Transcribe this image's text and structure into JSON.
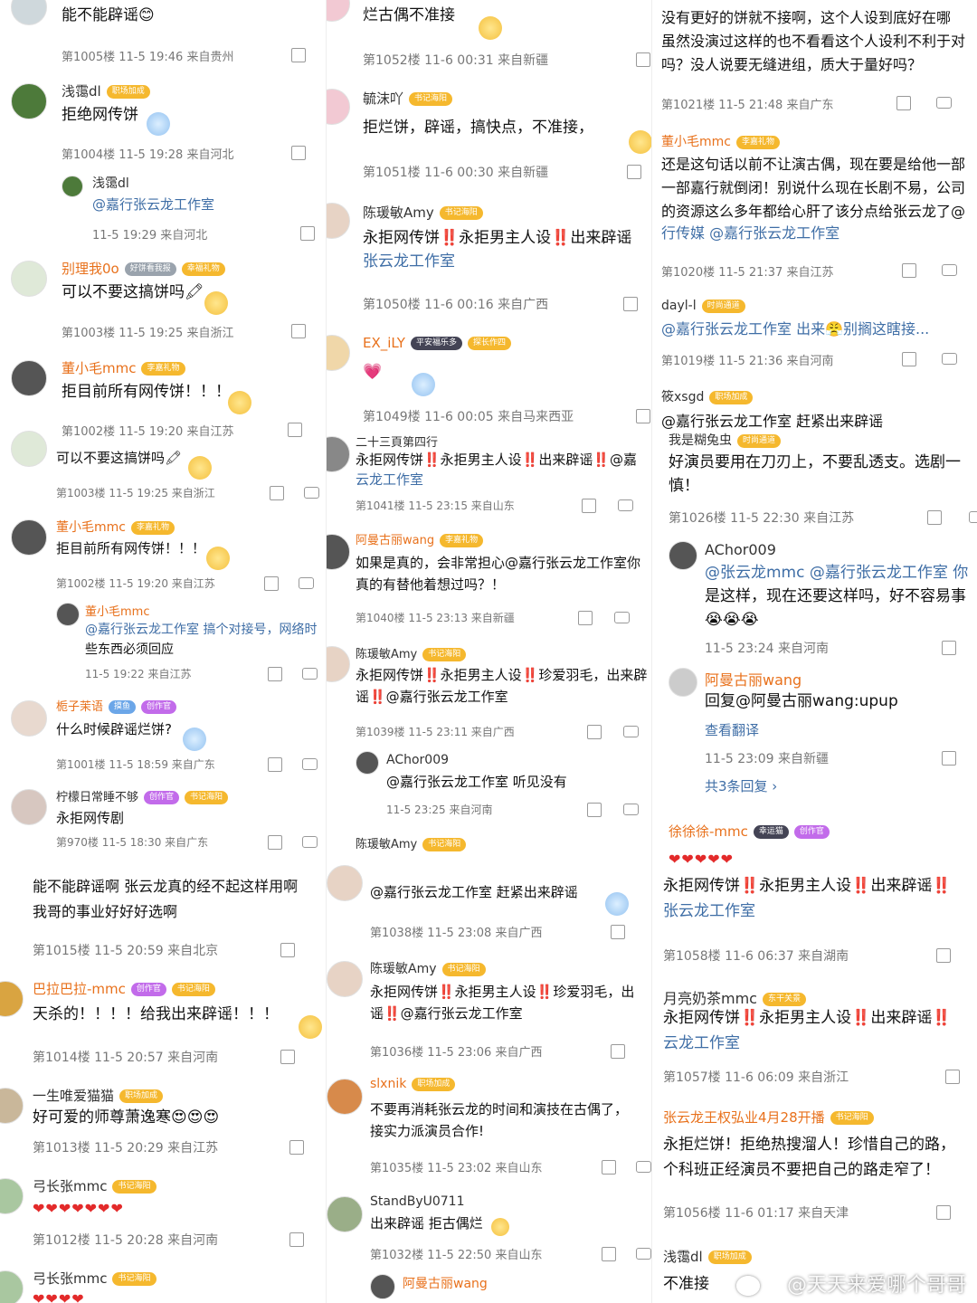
{
  "col1": {
    "e1": {
      "text": "能不能辟谣😊",
      "meta": "第1005楼 11-5 19:46 来自贵州"
    },
    "e2": {
      "name": "浅霭dl",
      "badge": "职场加成",
      "text": "拒绝网传饼",
      "meta": "第1004楼 11-5 19:28 来自河北",
      "reply": {
        "name": "浅霭dl",
        "text": "@嘉行张云龙工作室",
        "meta": "11-5 19:29 来自河北"
      }
    },
    "e3": {
      "name": "别理我0o",
      "badge": "好饼看我报",
      "badge2": "幸福礼物",
      "text": "可以不要这搞饼吗🖍",
      "meta": "第1003楼 11-5 19:25 来自浙江"
    },
    "e4": {
      "name": "董小毛mmc",
      "badge": "李嘉礼物",
      "text": "拒目前所有网传饼！！！",
      "meta": "第1002楼 11-5 19:20 来自江苏"
    },
    "e5": {
      "text": "可以不要这搞饼吗🖍",
      "meta": "第1003楼 11-5 19:25 来自浙江"
    },
    "e6": {
      "name": "董小毛mmc",
      "badge": "李嘉礼物",
      "text": "拒目前所有网传饼！！！",
      "meta": "第1002楼 11-5 19:20 来自江苏",
      "reply": {
        "name": "董小毛mmc",
        "text1": "@嘉行张云龙工作室 搞个对接号，网络时",
        "text2": "些东西必须回应",
        "meta": "11-5 19:22 来自江苏"
      }
    },
    "e7": {
      "name": "栀子茉语",
      "badge": "摸鱼",
      "badge2": "创作官",
      "text": "什么时候辟谣烂饼?",
      "meta": "第1001楼 11-5 18:59 来自广东"
    },
    "e8": {
      "name": "柠檬日常睡不够",
      "badge": "创作官",
      "badge2": "书记海阳",
      "text": "永拒网传剧",
      "meta": "第970楼 11-5 18:30 来自广东"
    },
    "e9": {
      "text1": "能不能辟谣啊 张云龙真的经不起这样用啊",
      "text2": "我哥的事业好好好选啊",
      "meta": "第1015楼 11-5 20:59 来自北京"
    },
    "e10": {
      "name": "巴拉巴拉-mmc",
      "badge": "创作官",
      "badge2": "书记海阳",
      "text": "天杀的！！！！给我出来辟谣！！！",
      "meta": "第1014楼 11-5 20:57 来自河南"
    },
    "e11": {
      "name": "一生唯爱猫猫",
      "badge": "职场加成",
      "text": "好可爱的师尊萧逸寒😍😍😍",
      "meta": "第1013楼 11-5 20:29 来自江苏"
    },
    "e12": {
      "name": "弓长张mmc",
      "badge": "书记海阳",
      "hearts": "❤❤❤❤❤❤❤",
      "meta": "第1012楼 11-5 20:28 来自河南"
    },
    "e13": {
      "name": "弓长张mmc",
      "badge": "书记海阳",
      "hearts": "❤❤❤❤"
    }
  },
  "col2": {
    "e1": {
      "text": "烂古偶不准接",
      "meta": "第1052楼 11-6 00:31 来自新疆"
    },
    "e2": {
      "name": "毓沫吖",
      "badge": "书记海阳",
      "text": "拒烂饼，辟谣，搞快点，不准接，",
      "meta": "第1051楼 11-6 00:30 来自新疆"
    },
    "e3": {
      "name": "陈瑗敏Amy",
      "badge": "书记海阳",
      "text1": "永拒网传饼‼️永拒男主人设‼️出来辟谣",
      "text2": "张云龙工作室",
      "meta": "第1050楼 11-6 00:16 来自广西"
    },
    "e4": {
      "name": "EX_iLY",
      "badge": "平安福乐多",
      "badge2": "探长作四",
      "text": "💗",
      "meta": "第1049楼 11-6 00:05 来自马来西亚"
    },
    "e5": {
      "name": "二十三頁第四行",
      "text1": "永拒网传饼‼️永拒男主人设‼️出来辟谣‼️@嘉",
      "text2": "云龙工作室",
      "meta": "第1041楼 11-5 23:15 来自山东"
    },
    "e6": {
      "name": "阿曼古丽wang",
      "badge": "李嘉礼物",
      "text1": "如果是真的，会非常担心@嘉行张云龙工作室你",
      "text2": "真的有替他着想过吗？！",
      "meta": "第1040楼 11-5 23:13 来自新疆"
    },
    "e7": {
      "name": "陈瑗敏Amy",
      "badge": "书记海阳",
      "text1": "永拒网传饼‼️永拒男主人设‼️珍爱羽毛，出来辟",
      "text2": "谣‼️@嘉行张云龙工作室",
      "meta": "第1039楼 11-5 23:11 来自广西",
      "reply": {
        "name": "AChor009",
        "text": "@嘉行张云龙工作室 听见没有",
        "meta": "11-5 23:25 来自河南"
      }
    },
    "e8": {
      "name": "陈瑗敏Amy",
      "badge": "书记海阳",
      "text": "@嘉行张云龙工作室 赶紧出来辟谣",
      "meta": "第1038楼 11-5 23:08 来自广西"
    },
    "e9": {
      "name": "陈瑗敏Amy",
      "badge": "书记海阳",
      "text1": "永拒网传饼‼️永拒男主人设‼️珍爱羽毛，出",
      "text2": "谣‼️@嘉行张云龙工作室",
      "meta": "第1036楼 11-5 23:06 来自广西"
    },
    "e10": {
      "name": "slxnik",
      "badge": "职场加成",
      "text1": "不要再消耗张云龙的时间和演技在古偶了，",
      "text2": "接实力派演员合作!",
      "meta": "第1035楼 11-5 23:02 来自山东"
    },
    "e11": {
      "name": "StandByU0711",
      "text": "出来辟谣 拒古偶烂",
      "meta": "第1032楼 11-5 22:50 来自山东"
    },
    "e12": {
      "name": "阿曼古丽wang"
    }
  },
  "col3": {
    "e1": {
      "text1": "没有更好的饼就不接啊，这个人设到底好在哪",
      "text2": "虽然没演过这样的也不看看这个人设利不利于对",
      "text3": "吗？没人说要无缝进组，质大于量好吗？",
      "meta": "第1021楼 11-5 21:48 来自广东"
    },
    "e2": {
      "name": "董小毛mmc",
      "badge": "李嘉礼物",
      "text1": "还是这句话以前不让演古偶，现在要是给他一部",
      "text2": "一部嘉行就倒闭！别说什么现在长剧不易，公司",
      "text3": "的资源这么多年都给心肝了该分点给张云龙了@",
      "text4": "行传媒 @嘉行张云龙工作室",
      "meta": "第1020楼 11-5 21:37 来自江苏"
    },
    "e3": {
      "name": "dayl-l",
      "badge": "时尚通道",
      "text": "@嘉行张云龙工作室 出来😤别搁这瞎接...",
      "meta": "第1019楼 11-5 21:36 来自河南"
    },
    "e4": {
      "name": "筱xsgd",
      "badge": "职场加成",
      "text": "@嘉行张云龙工作室 赶紧出来辟谣"
    },
    "e5": {
      "name": "我是糊兔虫",
      "badge": "时尚通道",
      "text1": "好演员要用在刀刃上，不要乱透支。选剧一",
      "text2": "慎！",
      "meta": "第1026楼 11-5 22:30 来自江苏",
      "reply1": {
        "name": "AChor009",
        "text1": "@张云龙mmc @嘉行张云龙工作室 你",
        "text2": "是这样，现在还要这样吗，好不容易事",
        "text3": "😭😭😭",
        "meta": "11-5 23:24 来自河南"
      },
      "reply2": {
        "name": "阿曼古丽wang",
        "text": "回复@阿曼古丽wang:upup",
        "translate": "查看翻译",
        "meta": "11-5 23:09 来自新疆"
      },
      "more": "共3条回复 ›"
    },
    "e6": {
      "name": "徐徐徐-mmc",
      "badge": "幸运猫",
      "badge2": "创作官",
      "hearts": "❤❤❤❤❤",
      "text1": "永拒网传饼‼️永拒男主人设‼️出来辟谣‼️",
      "text2": "张云龙工作室",
      "meta": "第1058楼 11-6 06:37 来自湖南"
    },
    "e7": {
      "name": "月亮奶茶mmc",
      "badge": "东干关景",
      "text1": "永拒网传饼‼️永拒男主人设‼️出来辟谣‼️",
      "text2": "云龙工作室",
      "meta": "第1057楼 11-6 06:09 来自浙江"
    },
    "e8": {
      "name": "张云龙王权弘业4月28开播",
      "badge": "书记海阳",
      "text1": "永拒烂饼！拒绝热搜溜人！珍惜自己的路，",
      "text2": "个科班正经演员不要把自己的路走窄了！",
      "meta": "第1056楼 11-6 01:17 来自天津"
    },
    "e9": {
      "name": "浅霭dl",
      "badge": "职场加成",
      "text": "不准接"
    }
  },
  "watermark": "@天天来爱哪个哥哥"
}
